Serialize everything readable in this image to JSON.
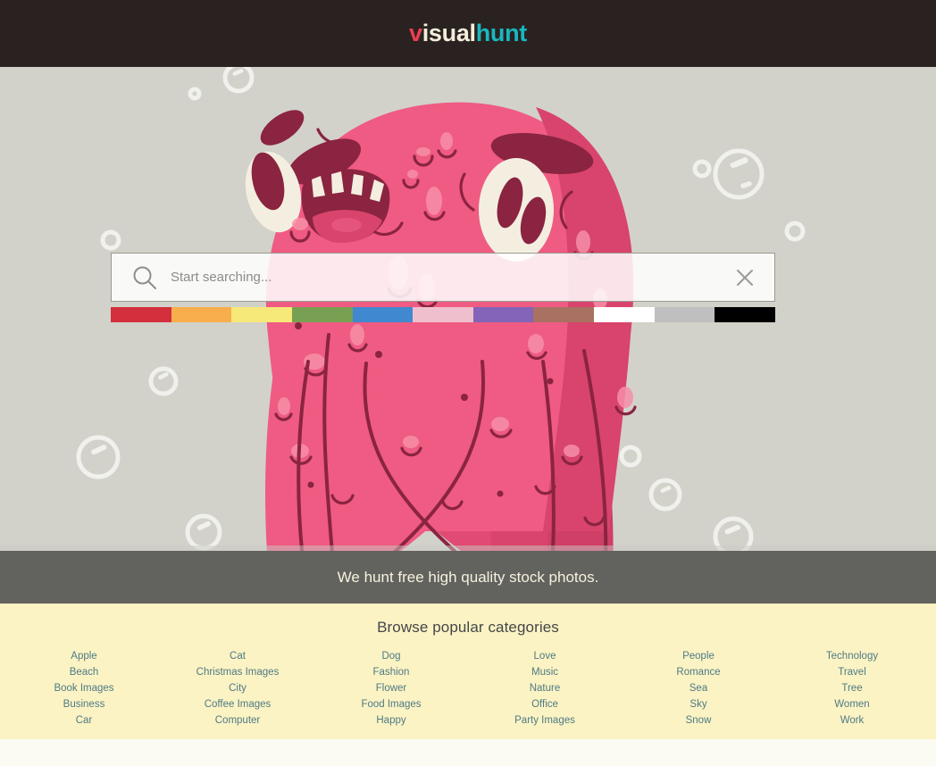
{
  "header": {
    "logo": {
      "part1": "v",
      "part2": "isual",
      "part3": "hunt"
    },
    "background_color": "#2a2220",
    "colors": {
      "v": "#f03e52",
      "isual": "#f3eedc",
      "hunt": "#18b8c0"
    }
  },
  "hero": {
    "background_color": "#d2d2ca",
    "illustration": "pink-monster-illustration",
    "search": {
      "placeholder": "Start searching...",
      "value": "",
      "search_icon": "search-icon",
      "clear_icon": "close-icon"
    },
    "color_swatches": [
      {
        "name": "red",
        "hex": "#d32f3c"
      },
      {
        "name": "orange",
        "hex": "#f9ae4d"
      },
      {
        "name": "yellow",
        "hex": "#f7e87a"
      },
      {
        "name": "green",
        "hex": "#78a052"
      },
      {
        "name": "blue",
        "hex": "#4089d0"
      },
      {
        "name": "pink",
        "hex": "#f0bfcd"
      },
      {
        "name": "purple",
        "hex": "#8364b8"
      },
      {
        "name": "brown",
        "hex": "#a87162"
      },
      {
        "name": "white",
        "hex": "#ffffff"
      },
      {
        "name": "gray",
        "hex": "#bfbfbf"
      },
      {
        "name": "black",
        "hex": "#000000"
      }
    ]
  },
  "tagline": {
    "text": "We hunt free high quality stock photos.",
    "background_color": "#3c3c3a",
    "text_color": "#f7f2dd"
  },
  "categories": {
    "title": "Browse popular categories",
    "background_color": "#fbf3c3",
    "link_color": "#4f7a86",
    "columns": [
      {
        "items": [
          "Apple",
          "Beach",
          "Book Images",
          "Business",
          "Car"
        ]
      },
      {
        "items": [
          "Cat",
          "Christmas Images",
          "City",
          "Coffee Images",
          "Computer"
        ]
      },
      {
        "items": [
          "Dog",
          "Fashion",
          "Flower",
          "Food Images",
          "Happy"
        ]
      },
      {
        "items": [
          "Love",
          "Music",
          "Nature",
          "Office",
          "Party Images"
        ]
      },
      {
        "items": [
          "People",
          "Romance",
          "Sea",
          "Sky",
          "Snow"
        ]
      },
      {
        "items": [
          "Technology",
          "Travel",
          "Tree",
          "Women",
          "Work"
        ]
      }
    ]
  }
}
